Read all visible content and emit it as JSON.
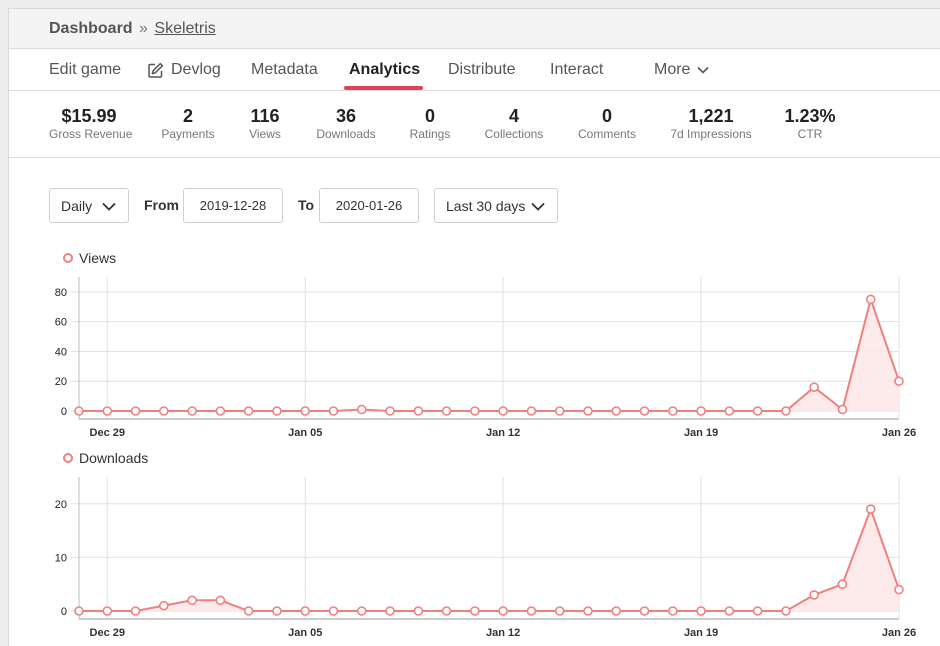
{
  "breadcrumb": {
    "home": "Dashboard",
    "separator": "»",
    "game": "Skeletris"
  },
  "nav": {
    "items": [
      {
        "label": "Edit game"
      },
      {
        "label": "Devlog",
        "icon": "pencil-square-icon"
      },
      {
        "label": "Metadata"
      },
      {
        "label": "Analytics",
        "active": true
      },
      {
        "label": "Distribute"
      },
      {
        "label": "Interact"
      },
      {
        "label": "More",
        "icon": "chevron-down-icon"
      }
    ]
  },
  "stats": [
    {
      "value": "$15.99",
      "label": "Gross Revenue"
    },
    {
      "value": "2",
      "label": "Payments"
    },
    {
      "value": "116",
      "label": "Views"
    },
    {
      "value": "36",
      "label": "Downloads"
    },
    {
      "value": "0",
      "label": "Ratings"
    },
    {
      "value": "4",
      "label": "Collections"
    },
    {
      "value": "0",
      "label": "Comments"
    },
    {
      "value": "1,221",
      "label": "7d Impressions"
    },
    {
      "value": "1.23%",
      "label": "CTR"
    }
  ],
  "controls": {
    "interval": "Daily",
    "from_label": "From",
    "from_value": "2019-12-28",
    "to_label": "To",
    "to_value": "2020-01-26",
    "range": "Last 30 days"
  },
  "colors": {
    "accent": "#de425b",
    "series": "#f08080",
    "area": "#fde8e8"
  },
  "chart_data": [
    {
      "type": "area",
      "title": "",
      "series": [
        {
          "name": "Views",
          "values": [
            0,
            0,
            0,
            0,
            0,
            0,
            0,
            0,
            0,
            0,
            1,
            0,
            0,
            0,
            0,
            0,
            0,
            0,
            0,
            0,
            0,
            0,
            0,
            0,
            0,
            0,
            16,
            1,
            75,
            20
          ]
        }
      ],
      "x": [
        "2019-12-28",
        "2019-12-29",
        "2019-12-30",
        "2019-12-31",
        "2020-01-01",
        "2020-01-02",
        "2020-01-03",
        "2020-01-04",
        "2020-01-05",
        "2020-01-06",
        "2020-01-07",
        "2020-01-08",
        "2020-01-09",
        "2020-01-10",
        "2020-01-11",
        "2020-01-12",
        "2020-01-13",
        "2020-01-14",
        "2020-01-15",
        "2020-01-16",
        "2020-01-17",
        "2020-01-18",
        "2020-01-19",
        "2020-01-20",
        "2020-01-21",
        "2020-01-22",
        "2020-01-23",
        "2020-01-24",
        "2020-01-25",
        "2020-01-26"
      ],
      "xticks": [
        "Dec 29",
        "Jan 05",
        "Jan 12",
        "Jan 19",
        "Jan 26"
      ],
      "yticks": [
        0,
        20,
        40,
        60,
        80
      ],
      "ylim": [
        0,
        90
      ],
      "legend": "top-left",
      "grid": true
    },
    {
      "type": "area",
      "title": "",
      "series": [
        {
          "name": "Downloads",
          "values": [
            0,
            0,
            0,
            1,
            2,
            2,
            0,
            0,
            0,
            0,
            0,
            0,
            0,
            0,
            0,
            0,
            0,
            0,
            0,
            0,
            0,
            0,
            0,
            0,
            0,
            0,
            3,
            5,
            19,
            4
          ]
        }
      ],
      "x": [
        "2019-12-28",
        "2019-12-29",
        "2019-12-30",
        "2019-12-31",
        "2020-01-01",
        "2020-01-02",
        "2020-01-03",
        "2020-01-04",
        "2020-01-05",
        "2020-01-06",
        "2020-01-07",
        "2020-01-08",
        "2020-01-09",
        "2020-01-10",
        "2020-01-11",
        "2020-01-12",
        "2020-01-13",
        "2020-01-14",
        "2020-01-15",
        "2020-01-16",
        "2020-01-17",
        "2020-01-18",
        "2020-01-19",
        "2020-01-20",
        "2020-01-21",
        "2020-01-22",
        "2020-01-23",
        "2020-01-24",
        "2020-01-25",
        "2020-01-26"
      ],
      "xticks": [
        "Dec 29",
        "Jan 05",
        "Jan 12",
        "Jan 19",
        "Jan 26"
      ],
      "yticks": [
        0,
        10,
        20
      ],
      "ylim": [
        0,
        25
      ],
      "legend": "top-left",
      "grid": true
    }
  ]
}
